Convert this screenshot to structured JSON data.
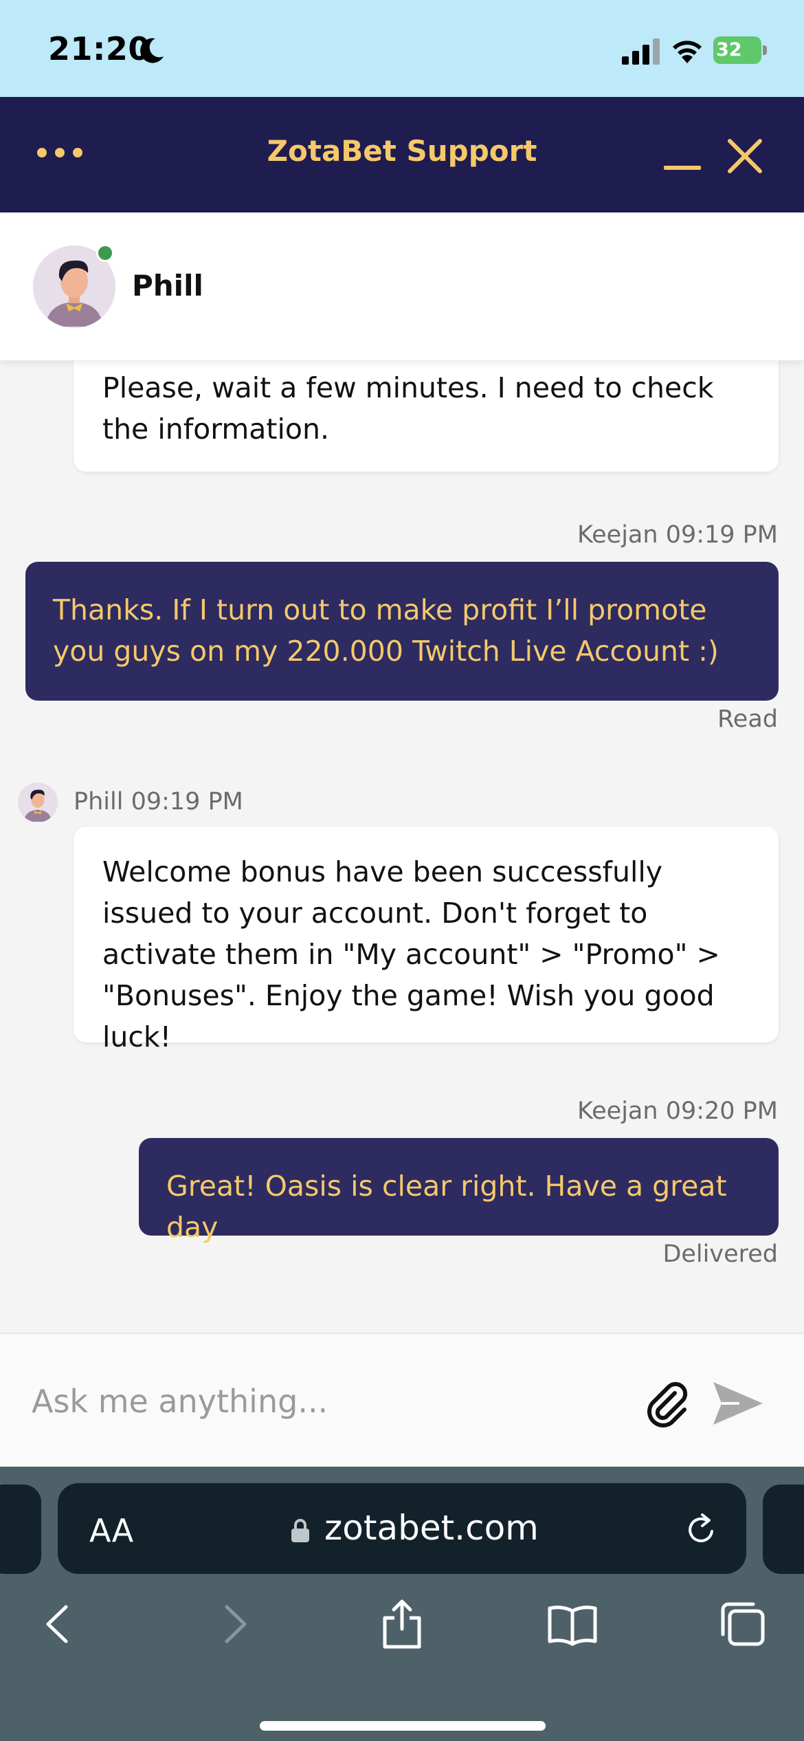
{
  "status_bar": {
    "time": "21:20",
    "battery": "32"
  },
  "header": {
    "title": "ZotaBet Support"
  },
  "agent": {
    "name": "Phill",
    "online": true
  },
  "messages": [
    {
      "from": "agent",
      "text": "Please, wait a few minutes. I need to check the information."
    },
    {
      "from": "user",
      "meta": "Keejan 09:19 PM",
      "text": "Thanks. If I turn out to make profit I’ll promote you guys on my 220.000 Twitch Live Account :)",
      "status": "Read"
    },
    {
      "from": "agent",
      "meta": "Phill 09:19 PM",
      "text": "Welcome bonus have been successfully issued to your account. Don't forget to activate them in \"My account\" > \"Promo\" > \"Bonuses\". Enjoy the game! Wish you good luck!"
    },
    {
      "from": "user",
      "meta": "Keejan 09:20 PM",
      "text": "Great! Oasis is clear right. Have a great day",
      "status": "Delivered"
    }
  ],
  "composer": {
    "placeholder": "Ask me anything..."
  },
  "browser": {
    "text_size_label": "AA",
    "url": "zotabet.com"
  },
  "colors": {
    "header_bg": "#1f1c4f",
    "accent": "#f5c96a",
    "user_bubble": "#2e2b61",
    "online": "#3b9a4e",
    "status_bar_bg": "#bde9f9"
  }
}
